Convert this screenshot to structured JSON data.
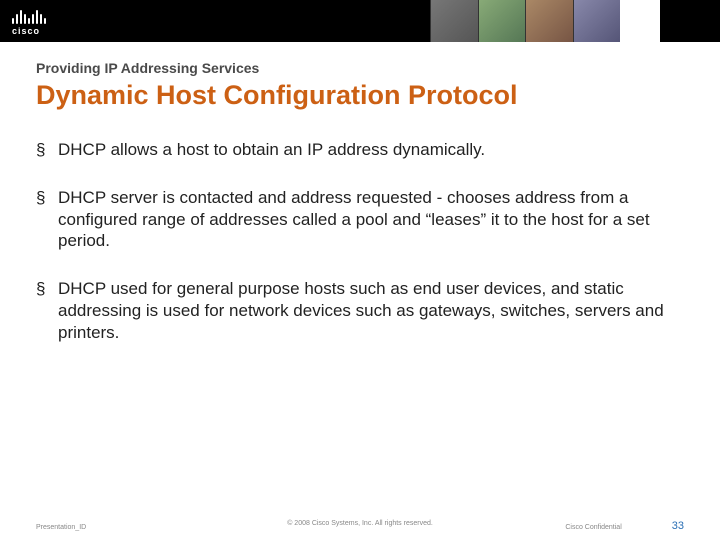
{
  "brand": {
    "name": "cisco"
  },
  "header": {
    "kicker": "Providing IP Addressing Services",
    "title": "Dynamic Host Configuration Protocol"
  },
  "bullets": [
    "DHCP allows a host to obtain an IP address dynamically.",
    "DHCP server is contacted and address requested - chooses address from a configured range of addresses called a pool and “leases” it to the host for a set period.",
    "DHCP used for general purpose hosts such as end user devices, and static addressing is used for network devices such as gateways, switches, servers and printers."
  ],
  "footer": {
    "left": "Presentation_ID",
    "center": "© 2008 Cisco Systems, Inc. All rights reserved.",
    "confidential": "Cisco Confidential",
    "page": "33"
  }
}
